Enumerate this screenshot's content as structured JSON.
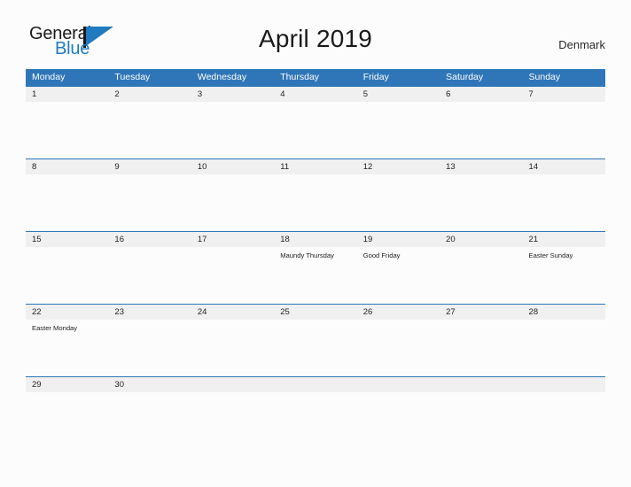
{
  "logo": {
    "word_top": "General",
    "word_bottom": "Blue",
    "flag_icon": "flag-triangle-icon"
  },
  "header": {
    "title": "April 2019",
    "country": "Denmark"
  },
  "colors": {
    "header_blue": "#2f76b8",
    "band_gray": "#f0f0f0",
    "logo_blue": "#1f7ac0",
    "page_background": "#fcfcfc"
  },
  "calendar": {
    "weekdays": [
      "Monday",
      "Tuesday",
      "Wednesday",
      "Thursday",
      "Friday",
      "Saturday",
      "Sunday"
    ],
    "weeks": [
      [
        {
          "date": "1",
          "event": ""
        },
        {
          "date": "2",
          "event": ""
        },
        {
          "date": "3",
          "event": ""
        },
        {
          "date": "4",
          "event": ""
        },
        {
          "date": "5",
          "event": ""
        },
        {
          "date": "6",
          "event": ""
        },
        {
          "date": "7",
          "event": ""
        }
      ],
      [
        {
          "date": "8",
          "event": ""
        },
        {
          "date": "9",
          "event": ""
        },
        {
          "date": "10",
          "event": ""
        },
        {
          "date": "11",
          "event": ""
        },
        {
          "date": "12",
          "event": ""
        },
        {
          "date": "13",
          "event": ""
        },
        {
          "date": "14",
          "event": ""
        }
      ],
      [
        {
          "date": "15",
          "event": ""
        },
        {
          "date": "16",
          "event": ""
        },
        {
          "date": "17",
          "event": ""
        },
        {
          "date": "18",
          "event": "Maundy Thursday"
        },
        {
          "date": "19",
          "event": "Good Friday"
        },
        {
          "date": "20",
          "event": ""
        },
        {
          "date": "21",
          "event": "Easter Sunday"
        }
      ],
      [
        {
          "date": "22",
          "event": "Easter Monday"
        },
        {
          "date": "23",
          "event": ""
        },
        {
          "date": "24",
          "event": ""
        },
        {
          "date": "25",
          "event": ""
        },
        {
          "date": "26",
          "event": ""
        },
        {
          "date": "27",
          "event": ""
        },
        {
          "date": "28",
          "event": ""
        }
      ],
      [
        {
          "date": "29",
          "event": ""
        },
        {
          "date": "30",
          "event": ""
        },
        {
          "date": "",
          "event": ""
        },
        {
          "date": "",
          "event": ""
        },
        {
          "date": "",
          "event": ""
        },
        {
          "date": "",
          "event": ""
        },
        {
          "date": "",
          "event": ""
        }
      ]
    ]
  }
}
